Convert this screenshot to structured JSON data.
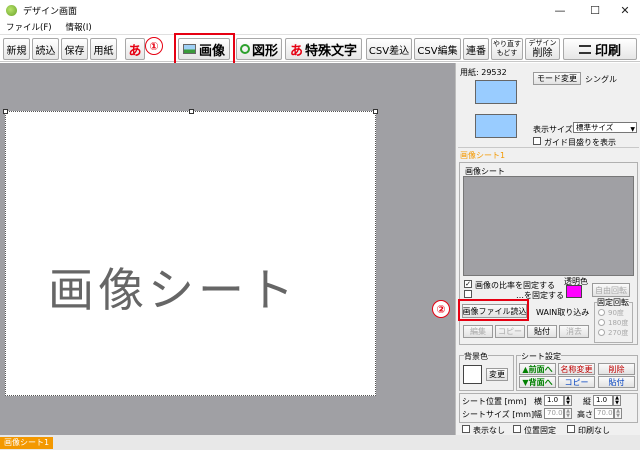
{
  "window": {
    "title": "デザイン画面",
    "minimize": "—",
    "maximize": "☐",
    "close": "✕"
  },
  "menu": {
    "file": "ファイル(F)",
    "info": "情報(I)"
  },
  "toolbar": {
    "new": "新規",
    "load": "読込",
    "save": "保存",
    "paper": "用紙",
    "text_icon": "あ",
    "image": "画像",
    "shape": "図形",
    "special_icon": "あ",
    "special": "特殊文字",
    "csv_import": "CSV差込",
    "csv_edit": "CSV編集",
    "serial": "連番",
    "redo": "やり直す",
    "undo": "もどす",
    "design_small": "デザイン",
    "delete": "削除",
    "print": "印刷"
  },
  "callouts": {
    "one": "①",
    "two": "②"
  },
  "canvas": {
    "sheet_text": "画像シート"
  },
  "status": {
    "tab": "画像シート1"
  },
  "panel": {
    "paper_label": "用紙: 29532",
    "mode_button": "モード変更",
    "mode_value": "シングル",
    "display_size_label": "表示サイズ",
    "display_size_value": "標準サイズ",
    "guide_label": "ガイド目盛りを表示",
    "sheet_title": "画像シート1",
    "image_group_label": "画像シート",
    "keep_ratio": "画像の比率を固定する",
    "hidden_option": "…を固定する",
    "transparent_label": "透明色",
    "free_rotate": "自由回転",
    "load_image": "画像ファイル読込",
    "wain_import": "WAIN取り込み",
    "fixed_rotate": "固定回転",
    "rot90": "90度",
    "rot180": "180度",
    "rot270": "270度",
    "edit": "編集",
    "copy": "コピー",
    "paste": "貼付",
    "erase": "消去",
    "bg_color": "背景色",
    "change": "変更",
    "sheet_settings": "シート設定",
    "front": "▲前面へ",
    "back": "▼背面へ",
    "rename": "名称変更",
    "copy2": "コピー",
    "remove": "削除",
    "paste2": "貼付",
    "pos_label": "シート位置 [mm]",
    "w_axis": "横",
    "w_value": "1.0",
    "h_axis": "縦",
    "h_value": "1.0",
    "size_label": "シートサイズ [mm]",
    "width_label": "幅",
    "width_value": "70.0",
    "height_label": "高さ",
    "height_value": "70.0",
    "no_display": "表示なし",
    "pos_fixed": "位置固定",
    "no_print": "印刷なし"
  },
  "colors": {
    "toolbar_bg": "#ffe100",
    "highlight": "#e60012",
    "swatch": "#99ccff",
    "transparent_swatch": "#ff00ff",
    "accent": "#f39800"
  }
}
